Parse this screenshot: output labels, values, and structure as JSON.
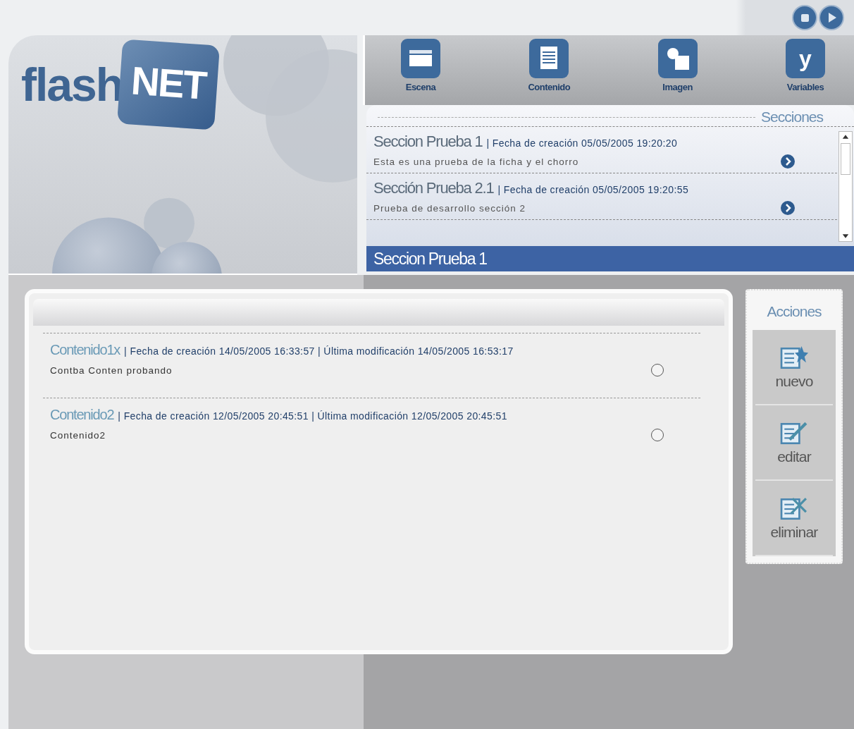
{
  "logo": {
    "word": "flash",
    "badge": "NET"
  },
  "toolbar": [
    {
      "kind": "scene",
      "label": "Escena"
    },
    {
      "kind": "content",
      "label": "Contenido"
    },
    {
      "kind": "image",
      "label": "Imagen"
    },
    {
      "kind": "variables",
      "label": "Variables",
      "glyph": "y"
    }
  ],
  "sections": {
    "title": "Secciones",
    "items": [
      {
        "name": "Seccion Prueba 1",
        "meta": "| Fecha de creación 05/05/2005 19:20:20",
        "description": "Esta es una prueba de la ficha y el chorro"
      },
      {
        "name": "Sección Prueba 2.1",
        "meta": "| Fecha de creación 05/05/2005 19:20:55",
        "description": "Prueba de desarrollo sección 2"
      }
    ],
    "current": "Seccion Prueba 1"
  },
  "contents": [
    {
      "name": "Contenido1x",
      "meta": "| Fecha de creación 14/05/2005 16:33:57  | Última modificación 14/05/2005 16:53:17",
      "description": "Contba Conten probando",
      "selected": false
    },
    {
      "name": "Contenido2",
      "meta": "| Fecha de creación 12/05/2005 20:45:51  | Última modificación 12/05/2005 20:45:51",
      "description": "Contenido2",
      "selected": false
    }
  ],
  "actions": {
    "title": "Acciones",
    "items": [
      {
        "kind": "new",
        "label": "nuevo"
      },
      {
        "kind": "edit",
        "label": "editar"
      },
      {
        "kind": "delete",
        "label": "eliminar"
      }
    ]
  }
}
